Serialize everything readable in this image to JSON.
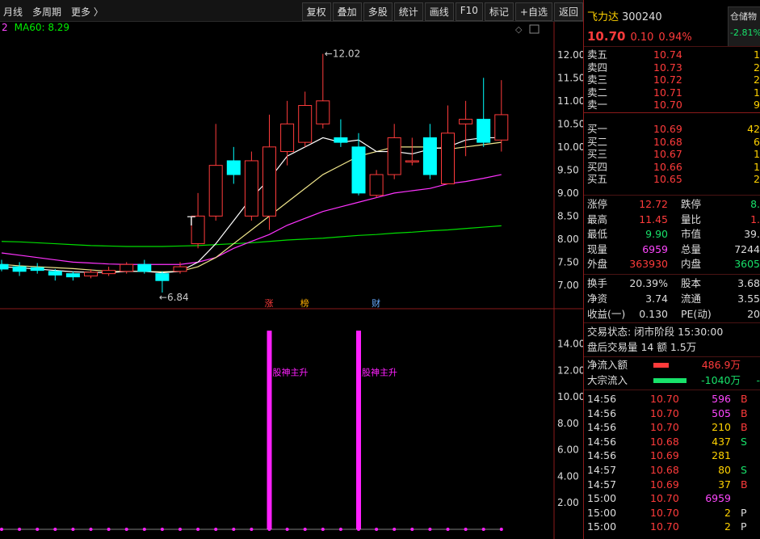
{
  "toolbar": {
    "left": [
      "月线",
      "多周期",
      "更多 〉"
    ],
    "right": [
      "复权",
      "叠加",
      "多股",
      "统计",
      "画线",
      "F10",
      "标记",
      "+自选",
      "返回"
    ]
  },
  "ma_label": "MA60: 8.29",
  "ma_prefix": "2",
  "peaks": {
    "high": "12.02",
    "low": "6.84"
  },
  "events": [
    "涨",
    "榜",
    "财"
  ],
  "main_axis": [
    "12.00",
    "11.50",
    "11.00",
    "10.50",
    "10.00",
    "9.50",
    "9.00",
    "8.50",
    "8.00",
    "7.50",
    "7.00"
  ],
  "sub_axis": [
    "14.00",
    "12.00",
    "10.00",
    "8.00",
    "6.00",
    "4.00",
    "2.00"
  ],
  "signal_label": "股神主升",
  "colors": {
    "up": "#ff3b3b",
    "down": "#00ffff",
    "ma5": "#ffffff",
    "ma10": "#f0e68c",
    "ma30": "#ff33ff",
    "ma60": "#00dd00",
    "signal": "#ff20ff"
  },
  "chart_data": {
    "type": "candlestick",
    "candles": [
      {
        "o": 7.45,
        "c": 7.35,
        "h": 7.55,
        "l": 7.3
      },
      {
        "o": 7.4,
        "c": 7.3,
        "h": 7.5,
        "l": 7.2
      },
      {
        "o": 7.38,
        "c": 7.32,
        "h": 7.48,
        "l": 7.25
      },
      {
        "o": 7.3,
        "c": 7.22,
        "h": 7.35,
        "l": 7.1
      },
      {
        "o": 7.25,
        "c": 7.18,
        "h": 7.3,
        "l": 7.1
      },
      {
        "o": 7.2,
        "c": 7.28,
        "h": 7.35,
        "l": 7.15
      },
      {
        "o": 7.25,
        "c": 7.32,
        "h": 7.4,
        "l": 7.2
      },
      {
        "o": 7.3,
        "c": 7.45,
        "h": 7.5,
        "l": 7.25
      },
      {
        "o": 7.45,
        "c": 7.3,
        "h": 7.55,
        "l": 7.25
      },
      {
        "o": 7.25,
        "c": 7.1,
        "h": 7.3,
        "l": 6.84
      },
      {
        "o": 7.3,
        "c": 7.4,
        "h": 7.5,
        "l": 7.25
      },
      {
        "o": 7.9,
        "c": 8.5,
        "h": 9.0,
        "l": 7.8
      },
      {
        "o": 8.5,
        "c": 9.6,
        "h": 10.5,
        "l": 8.4
      },
      {
        "o": 9.7,
        "c": 9.4,
        "h": 10.0,
        "l": 9.2
      },
      {
        "o": 8.5,
        "c": 9.7,
        "h": 9.9,
        "l": 8.4
      },
      {
        "o": 8.5,
        "c": 10.0,
        "h": 10.7,
        "l": 8.2
      },
      {
        "o": 9.9,
        "c": 10.5,
        "h": 11.0,
        "l": 9.6
      },
      {
        "o": 10.1,
        "c": 10.9,
        "h": 11.2,
        "l": 10.0
      },
      {
        "o": 10.5,
        "c": 11.0,
        "h": 12.02,
        "l": 10.4
      },
      {
        "o": 10.2,
        "c": 10.1,
        "h": 10.6,
        "l": 10.0
      },
      {
        "o": 10.0,
        "c": 9.0,
        "h": 10.3,
        "l": 8.95
      },
      {
        "o": 8.95,
        "c": 9.4,
        "h": 9.5,
        "l": 8.9
      },
      {
        "o": 9.4,
        "c": 10.2,
        "h": 10.5,
        "l": 9.3
      },
      {
        "o": 9.7,
        "c": 9.7,
        "h": 10.2,
        "l": 9.6
      },
      {
        "o": 10.2,
        "c": 9.4,
        "h": 10.5,
        "l": 9.3
      },
      {
        "o": 9.2,
        "c": 10.3,
        "h": 10.9,
        "l": 9.2
      },
      {
        "o": 10.5,
        "c": 10.6,
        "h": 11.0,
        "l": 9.8
      },
      {
        "o": 10.6,
        "c": 10.1,
        "h": 11.5,
        "l": 10.0
      },
      {
        "o": 10.15,
        "c": 10.7,
        "h": 11.45,
        "l": 9.9
      }
    ],
    "ma5": [
      7.4,
      7.38,
      7.35,
      7.32,
      7.29,
      7.28,
      7.27,
      7.3,
      7.3,
      7.27,
      7.3,
      7.5,
      7.9,
      8.4,
      8.9,
      9.3,
      9.8,
      10.0,
      10.2,
      10.1,
      10.15,
      9.9,
      9.9,
      9.85,
      9.95,
      10.0,
      10.15,
      10.2,
      10.2
    ],
    "ma10": [
      7.45,
      7.42,
      7.4,
      7.38,
      7.36,
      7.33,
      7.3,
      7.3,
      7.3,
      7.29,
      7.3,
      7.4,
      7.6,
      7.9,
      8.2,
      8.5,
      8.8,
      9.1,
      9.4,
      9.6,
      9.8,
      9.9,
      10.0,
      10.0,
      10.0,
      9.95,
      10.0,
      10.05,
      10.1
    ],
    "ma30": [
      7.7,
      7.65,
      7.6,
      7.55,
      7.5,
      7.48,
      7.46,
      7.45,
      7.45,
      7.45,
      7.45,
      7.5,
      7.6,
      7.8,
      7.95,
      8.1,
      8.3,
      8.45,
      8.6,
      8.7,
      8.8,
      8.9,
      9.0,
      9.05,
      9.1,
      9.2,
      9.25,
      9.32,
      9.4
    ],
    "ma60": [
      7.95,
      7.94,
      7.92,
      7.9,
      7.88,
      7.86,
      7.85,
      7.84,
      7.84,
      7.84,
      7.85,
      7.86,
      7.88,
      7.9,
      7.92,
      7.95,
      7.98,
      8.0,
      8.02,
      8.05,
      8.08,
      8.1,
      8.13,
      8.15,
      8.18,
      8.2,
      8.23,
      8.26,
      8.29
    ],
    "signal": [
      0,
      0,
      0,
      0,
      0,
      0,
      0,
      0,
      0,
      0,
      0,
      0,
      0,
      0,
      0,
      15,
      0,
      0,
      0,
      0,
      15,
      0,
      0,
      0,
      0,
      0,
      0,
      0,
      0
    ],
    "main_ylim": [
      6.7,
      12.4
    ],
    "sub_ylim": [
      0,
      15.5
    ]
  },
  "stock": {
    "name": "飞力达",
    "code": "300240",
    "price": "10.70",
    "change": "0.10",
    "pct": "0.94%"
  },
  "cang": {
    "label": "仓储物",
    "value": "-2.81%"
  },
  "sells": [
    {
      "name": "卖五",
      "price": "10.74",
      "vol": "1"
    },
    {
      "name": "卖四",
      "price": "10.73",
      "vol": "2"
    },
    {
      "name": "卖三",
      "price": "10.72",
      "vol": "2"
    },
    {
      "name": "卖二",
      "price": "10.71",
      "vol": "1"
    },
    {
      "name": "卖一",
      "price": "10.70",
      "vol": "9"
    }
  ],
  "buys": [
    {
      "name": "买一",
      "price": "10.69",
      "vol": "42"
    },
    {
      "name": "买二",
      "price": "10.68",
      "vol": "6"
    },
    {
      "name": "买三",
      "price": "10.67",
      "vol": "1"
    },
    {
      "name": "买四",
      "price": "10.66",
      "vol": "1"
    },
    {
      "name": "买五",
      "price": "10.65",
      "vol": "2"
    }
  ],
  "quote": [
    {
      "l1": "涨停",
      "v1": "12.72",
      "c1": "red",
      "l2": "跌停",
      "v2": "8.",
      "c2": "grn"
    },
    {
      "l1": "最高",
      "v1": "11.45",
      "c1": "red",
      "l2": "量比",
      "v2": "1.",
      "c2": "red"
    },
    {
      "l1": "最低",
      "v1": "9.90",
      "c1": "grn",
      "l2": "市值",
      "v2": "39.",
      "c2": "wht"
    },
    {
      "l1": "现量",
      "v1": "6959",
      "c1": "mag",
      "l2": "总量",
      "v2": "7244",
      "c2": "wht"
    },
    {
      "l1": "外盘",
      "v1": "363930",
      "c1": "red",
      "l2": "内盘",
      "v2": "3605",
      "c2": "grn"
    }
  ],
  "quote2": [
    {
      "l1": "换手",
      "v1": "20.39%",
      "l2": "股本",
      "v2": "3.68"
    },
    {
      "l1": "净资",
      "v1": "3.74",
      "l2": "流通",
      "v2": "3.55"
    },
    {
      "l1": "收益(一)",
      "v1": "0.130",
      "l2": "PE(动)",
      "v2": "20"
    }
  ],
  "trade_status": "交易状态: 闭市阶段 15:30:00",
  "after_hours": "盘后交易量 14 额 1.5万",
  "flows": [
    {
      "label": "净流入额",
      "value": "486.9万",
      "tail": "",
      "color": "red",
      "bar": 0.4
    },
    {
      "label": "大宗流入",
      "value": "-1040万",
      "tail": "-",
      "color": "grn",
      "bar": 0.85
    }
  ],
  "ticks": [
    {
      "t": "14:56",
      "p": "10.70",
      "pc": "red",
      "v": "596",
      "vc": "mag",
      "d": "B",
      "dc": "red"
    },
    {
      "t": "14:56",
      "p": "10.70",
      "pc": "red",
      "v": "505",
      "vc": "mag",
      "d": "B",
      "dc": "red"
    },
    {
      "t": "14:56",
      "p": "10.70",
      "pc": "red",
      "v": "210",
      "vc": "yel",
      "d": "B",
      "dc": "red"
    },
    {
      "t": "14:56",
      "p": "10.68",
      "pc": "red",
      "v": "437",
      "vc": "yel",
      "d": "S",
      "dc": "grn"
    },
    {
      "t": "14:56",
      "p": "10.69",
      "pc": "red",
      "v": "281",
      "vc": "yel",
      "d": "",
      "dc": "wht"
    },
    {
      "t": "14:57",
      "p": "10.68",
      "pc": "red",
      "v": "80",
      "vc": "yel",
      "d": "S",
      "dc": "grn"
    },
    {
      "t": "14:57",
      "p": "10.69",
      "pc": "red",
      "v": "37",
      "vc": "yel",
      "d": "B",
      "dc": "red"
    },
    {
      "t": "15:00",
      "p": "10.70",
      "pc": "red",
      "v": "6959",
      "vc": "mag",
      "d": "",
      "dc": "wht"
    },
    {
      "t": "15:00",
      "p": "10.70",
      "pc": "red",
      "v": "2",
      "vc": "yel",
      "d": "P",
      "dc": "wht"
    },
    {
      "t": "15:00",
      "p": "10.70",
      "pc": "red",
      "v": "2",
      "vc": "yel",
      "d": "P",
      "dc": "wht"
    }
  ]
}
